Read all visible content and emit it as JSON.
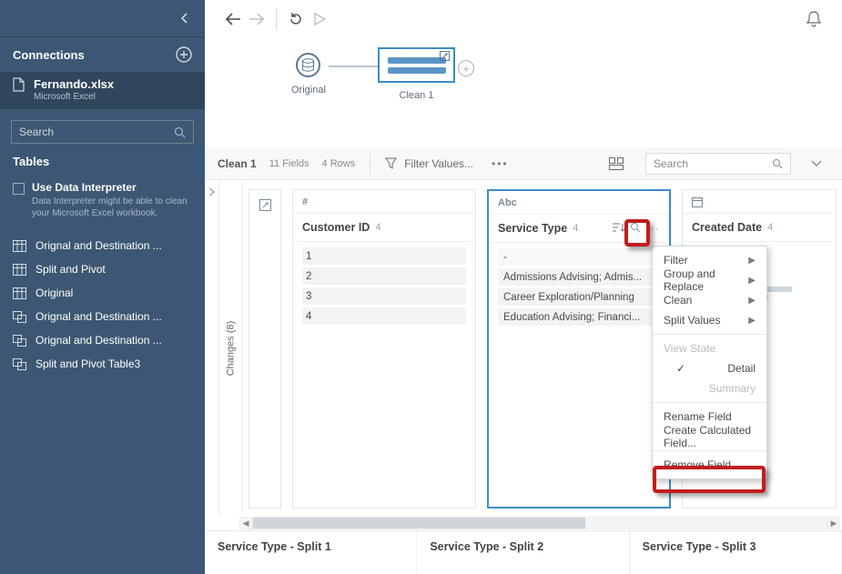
{
  "sidebar": {
    "connections_label": "Connections",
    "file_name": "Fernando.xlsx",
    "file_type": "Microsoft Excel",
    "search_placeholder": "Search",
    "tables_label": "Tables",
    "di_title": "Use Data Interpreter",
    "di_sub": "Data Interpreter might be able to clean your Microsoft Excel workbook.",
    "tables": [
      "Orignal and Destination ...",
      "Split and Pivot",
      "Original",
      "Orignal and Destination ...",
      "Orignal and Destination ...",
      "Split and Pivot Table3"
    ]
  },
  "flow": {
    "node_original": "Original",
    "node_clean": "Clean 1"
  },
  "step_header": {
    "name": "Clean 1",
    "fields": "11 Fields",
    "rows": "4 Rows",
    "filter_label": "Filter Values...",
    "search_placeholder": "Search"
  },
  "changes_label": "Changes (8)",
  "fields": {
    "customer": {
      "type": "#",
      "name": "Customer ID",
      "count": "4",
      "rows": [
        "1",
        "2",
        "3",
        "4"
      ]
    },
    "service": {
      "type": "Abc",
      "name": "Service Type",
      "count": "4",
      "rows": [
        "-",
        "Admissions Advising; Admis...",
        "Career Exploration/Planning",
        "Education Advising; Financi..."
      ]
    },
    "created": {
      "type": "date",
      "name": "Created Date",
      "count": "4"
    }
  },
  "footer": {
    "splits": [
      "Service Type - Split 1",
      "Service Type - Split 2",
      "Service Type - Split 3"
    ]
  },
  "context_menu": {
    "filter": "Filter",
    "group": "Group and Replace",
    "clean": "Clean",
    "split": "Split Values",
    "view_state": "View State",
    "detail": "Detail",
    "summary": "Summary",
    "rename": "Rename Field",
    "calc": "Create Calculated Field...",
    "remove": "Remove Field"
  }
}
